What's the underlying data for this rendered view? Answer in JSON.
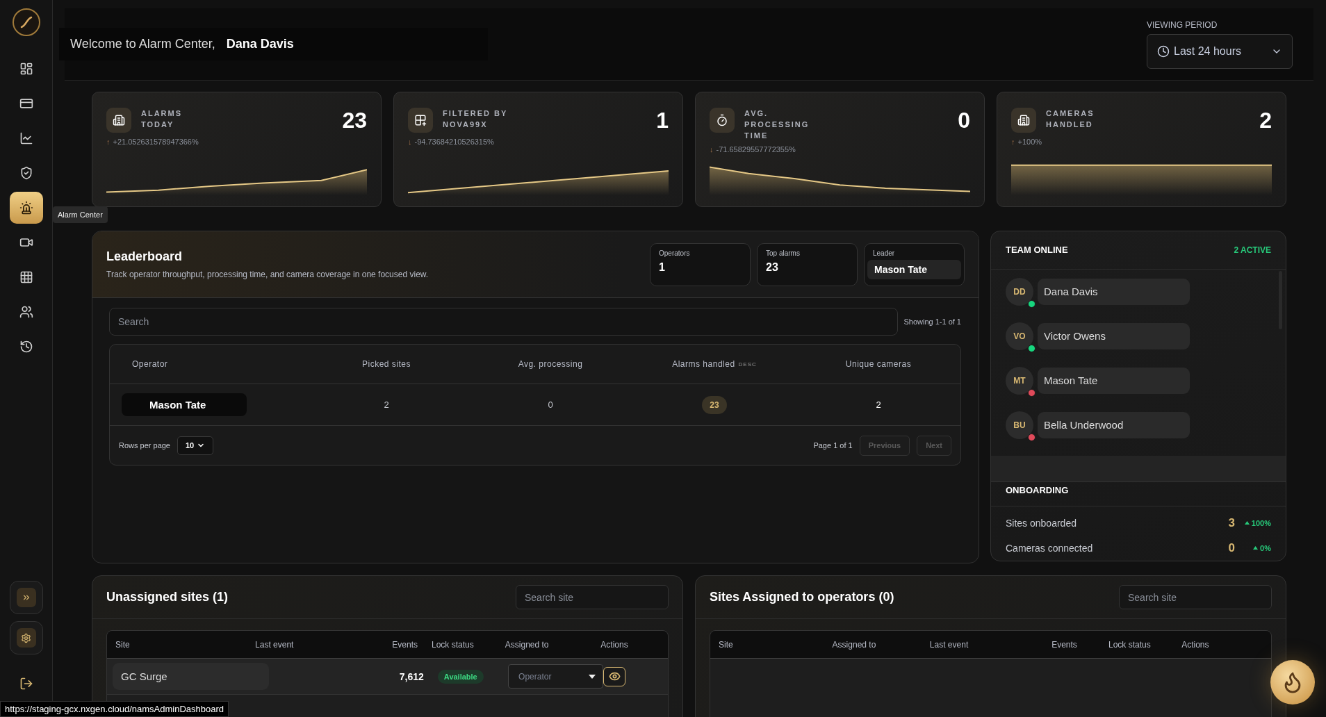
{
  "sidebar": {
    "nav_items": [
      {
        "selected": false
      },
      {
        "selected": false
      },
      {
        "selected": false
      },
      {
        "selected": false
      },
      {
        "selected": true
      },
      {
        "selected": false
      },
      {
        "selected": false
      },
      {
        "selected": false
      },
      {
        "selected": false
      }
    ],
    "tooltip": "Alarm Center"
  },
  "header": {
    "welcome": "Welcome to Alarm Center,",
    "user_name": "Dana Davis",
    "viewing_period": {
      "label": "VIEWING PERIOD",
      "value": "Last 24 hours"
    }
  },
  "stats": [
    {
      "label": "ALARMS TODAY",
      "value": "23",
      "arrow": "↑",
      "change": "+21.052631578947366%"
    },
    {
      "label": "FILTERED BY NOVA99X",
      "value": "1",
      "arrow": "↓",
      "change": "-94.73684210526315%"
    },
    {
      "label": "AVG. PROCESSING TIME",
      "value": "0",
      "arrow": "↓",
      "change": "-71.65829557772355%"
    },
    {
      "label": "CAMERAS HANDLED",
      "value": "2",
      "arrow": "↑",
      "change": "+100%"
    }
  ],
  "leaderboard": {
    "title": "Leaderboard",
    "subtitle": "Track operator throughput, processing time, and camera coverage in one focused view.",
    "summary": [
      {
        "label": "Operators",
        "value": "1"
      },
      {
        "label": "Top alarms",
        "value": "23"
      },
      {
        "label": "Leader",
        "value": "Mason Tate"
      }
    ],
    "search": {
      "placeholder": "Search"
    },
    "showing": "Showing 1-1 of 1",
    "columns": [
      {
        "label": "Operator"
      },
      {
        "label": "Picked sites"
      },
      {
        "label": "Avg. processing"
      },
      {
        "label": "Alarms handled",
        "sort": "DESC"
      },
      {
        "label": "Unique cameras"
      }
    ],
    "rows": [
      {
        "operator": "Mason Tate",
        "picked_sites": "2",
        "avg_processing": "0",
        "alarms_handled": "23",
        "unique_cameras": "2"
      }
    ],
    "footer": {
      "rows_per_page": "Rows per page",
      "page_size": "10",
      "page_info": "Page 1 of 1",
      "previous": {
        "label": "Previous",
        "disabled": true
      },
      "next": {
        "label": "Next",
        "disabled": true
      }
    }
  },
  "team_online": {
    "title": "TEAM ONLINE",
    "active": "2 ACTIVE",
    "members": [
      {
        "initials": "DD",
        "name": "Dana Davis",
        "online": true
      },
      {
        "initials": "VO",
        "name": "Victor Owens",
        "online": true
      },
      {
        "initials": "MT",
        "name": "Mason Tate",
        "online": false
      },
      {
        "initials": "BU",
        "name": "Bella Underwood",
        "online": false
      }
    ]
  },
  "onboarding": {
    "title": "ONBOARDING",
    "rows": [
      {
        "label": "Sites onboarded",
        "value": "3",
        "change": "100%"
      },
      {
        "label": "Cameras connected",
        "value": "0",
        "change": "0%"
      }
    ]
  },
  "unassigned_sites": {
    "title": "Unassigned sites (1)",
    "search": {
      "placeholder": "Search site"
    },
    "columns": [
      "Site",
      "Last event",
      "Events",
      "Lock status",
      "Assigned to",
      "Actions"
    ],
    "rows": [
      {
        "site": "GC Surge",
        "events": "7,612",
        "lock_status": "Available",
        "assign_placeholder": "Operator"
      }
    ]
  },
  "assigned_sites": {
    "title": "Sites Assigned to operators (0)",
    "search": {
      "placeholder": "Search site"
    },
    "columns": [
      "Site",
      "Assigned to",
      "Last event",
      "Events",
      "Lock status",
      "Actions"
    ]
  },
  "status_bar": "https://staging-gcx.nxgen.cloud/namsAdminDashboard"
}
